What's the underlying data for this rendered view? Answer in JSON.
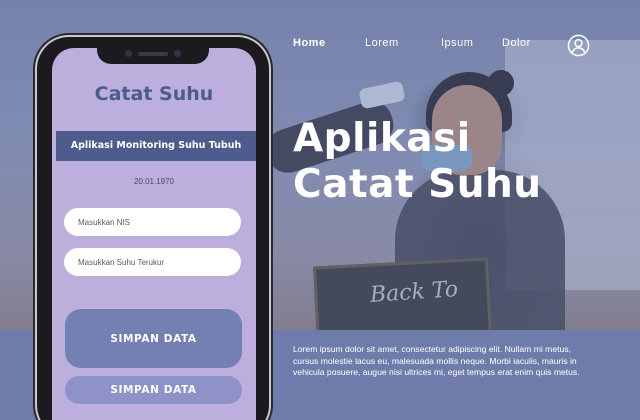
{
  "nav": {
    "items": [
      "Home",
      "Lorem",
      "Ipsum",
      "Dolor"
    ],
    "active": "Home",
    "user_icon": "user-circle-icon"
  },
  "hero": {
    "title_line1": "Aplikasi",
    "title_line2": "Catat Suhu",
    "description": "Lorem ipsum dolor sit amet, consectetur adipiscing elit. Nullam mi metus, cursus molestie lacus eu, malesuada mollis neque. Morbi iaculis, mauris in vehicula posuere, augue nisi ultrices mi, eget tempus erat enim quis metus."
  },
  "chalkboard_text": "Back To",
  "phone_app": {
    "title": "Catat Suhu",
    "banner": "Aplikasi Monitoring Suhu Tubuh",
    "date": "20.01.1970",
    "nis_placeholder": "Masukkan NIS",
    "suhu_placeholder": "Masukkan Suhu Terukur",
    "primary_button": "SIMPAN DATA",
    "secondary_button": "SIMPAN DATA"
  },
  "colors": {
    "accent": "#4e5b8d",
    "screen_bg": "#bcaedd",
    "panel_bg": "#6f7cab",
    "button_primary": "#7480b2",
    "button_secondary": "#8e92c6"
  }
}
